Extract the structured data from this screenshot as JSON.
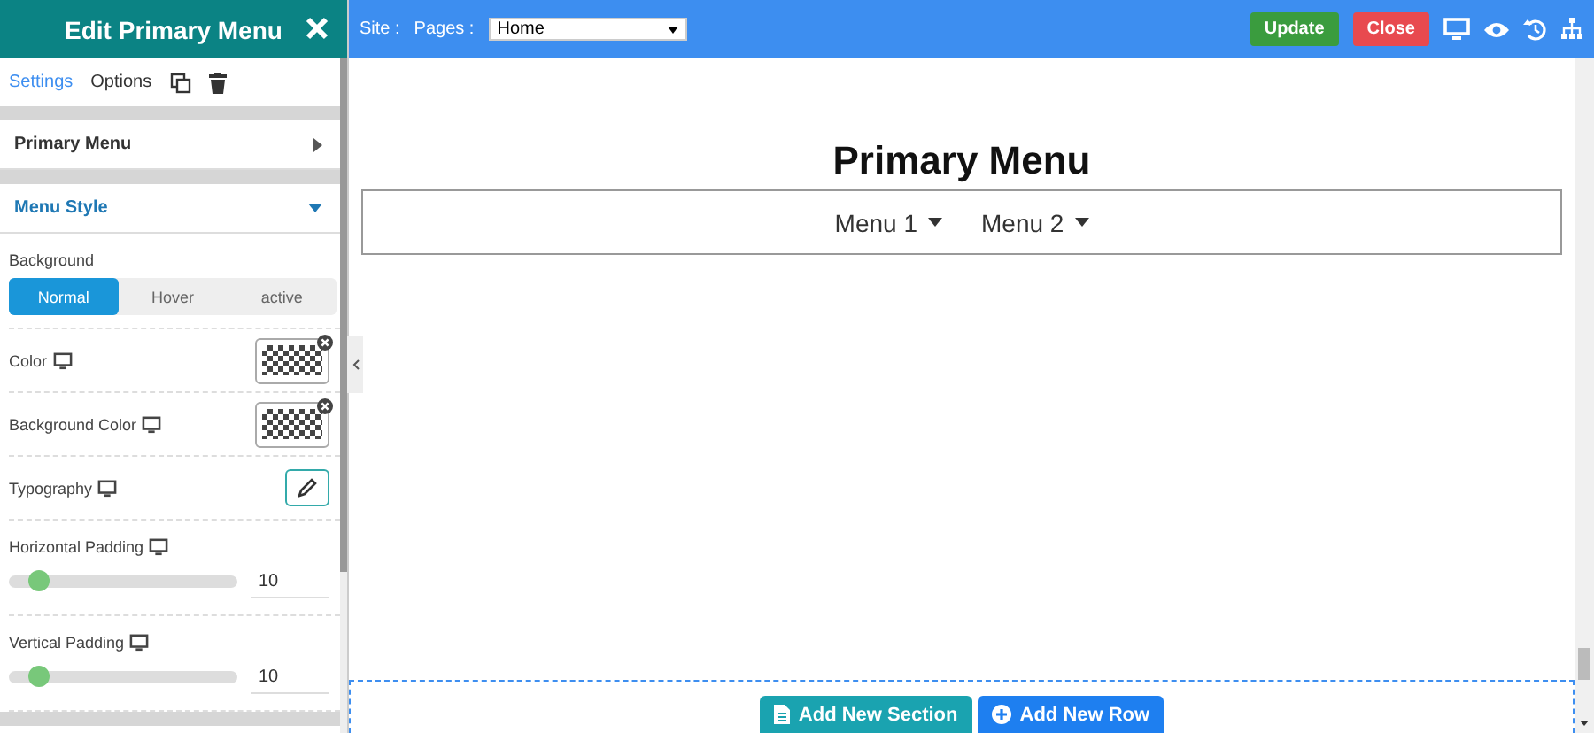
{
  "panel": {
    "title": "Edit Primary Menu",
    "tabs": [
      {
        "label": "Settings",
        "selected": true
      },
      {
        "label": "Options",
        "selected": false
      }
    ],
    "sections": [
      {
        "title": "Primary Menu",
        "expanded": false
      },
      {
        "title": "Menu Style",
        "expanded": true
      }
    ],
    "background": {
      "label": "Background",
      "states": [
        {
          "label": "Normal",
          "selected": true
        },
        {
          "label": "Hover",
          "selected": false
        },
        {
          "label": "active",
          "selected": false
        }
      ]
    },
    "rows": [
      {
        "kind": "color",
        "label": "Color"
      },
      {
        "kind": "color",
        "label": "Background Color"
      },
      {
        "kind": "edit",
        "label": "Typography"
      },
      {
        "kind": "slider",
        "label": "Horizontal Padding",
        "level": 0.13,
        "value": "10"
      },
      {
        "kind": "slider",
        "label": "Vertical Padding",
        "level": 0.13,
        "value": "10"
      }
    ]
  },
  "toolbar": {
    "site_label": "Site :",
    "pages_label": "Pages :",
    "page": "Home",
    "buttons": [
      {
        "label": "Update",
        "kind": "update"
      },
      {
        "label": "Close",
        "kind": "close"
      }
    ]
  },
  "canvas": {
    "heading": "Primary Menu",
    "menu_items": [
      "Menu 1",
      "Menu 2"
    ],
    "actions": [
      {
        "label": "Add New Section",
        "kind": "section"
      },
      {
        "label": "Add New Row",
        "kind": "row"
      }
    ]
  }
}
